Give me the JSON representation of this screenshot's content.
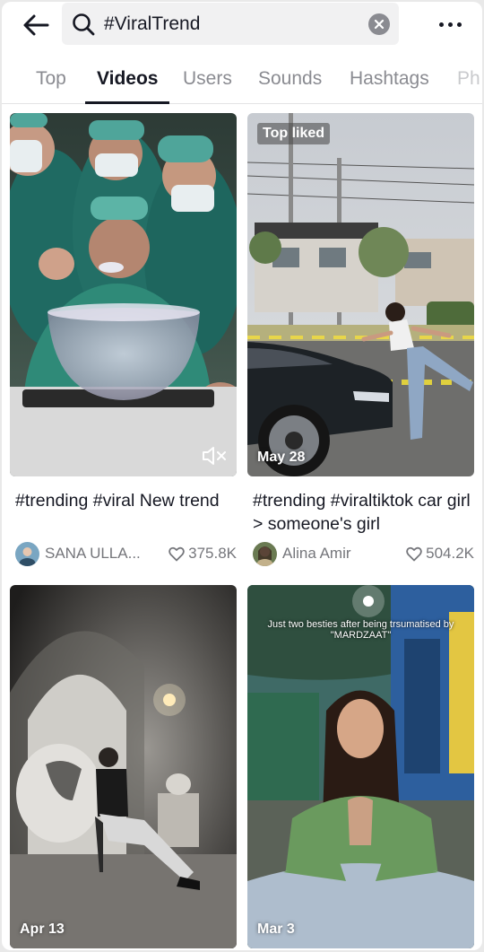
{
  "search": {
    "query": "#ViralTrend"
  },
  "tabs": [
    {
      "label": "Top"
    },
    {
      "label": "Videos"
    },
    {
      "label": "Users"
    },
    {
      "label": "Sounds"
    },
    {
      "label": "Hashtags"
    },
    {
      "label": "Ph"
    }
  ],
  "active_tab": "Videos",
  "videos": [
    {
      "caption": "#trending #viral New trend",
      "author": "SANA ULLA...",
      "likes": "375.8K",
      "badge": "",
      "date": "",
      "muted": true
    },
    {
      "caption": "#trending #viraltiktok car girl > someone's girl",
      "author": "Alina Amir",
      "likes": "504.2K",
      "badge": "Top liked",
      "date": "May 28"
    },
    {
      "date": "Apr 13"
    },
    {
      "date": "Mar 3",
      "overlay_text": "Just two besties after being trsumatised by \"MARDZAAT\""
    }
  ],
  "colors": {
    "text_primary": "#161823",
    "text_secondary": "#8a8b91",
    "search_bg": "#f1f1f2"
  },
  "icons": [
    "back-arrow-icon",
    "search-icon",
    "clear-icon",
    "more-icon",
    "mute-icon",
    "heart-icon"
  ]
}
